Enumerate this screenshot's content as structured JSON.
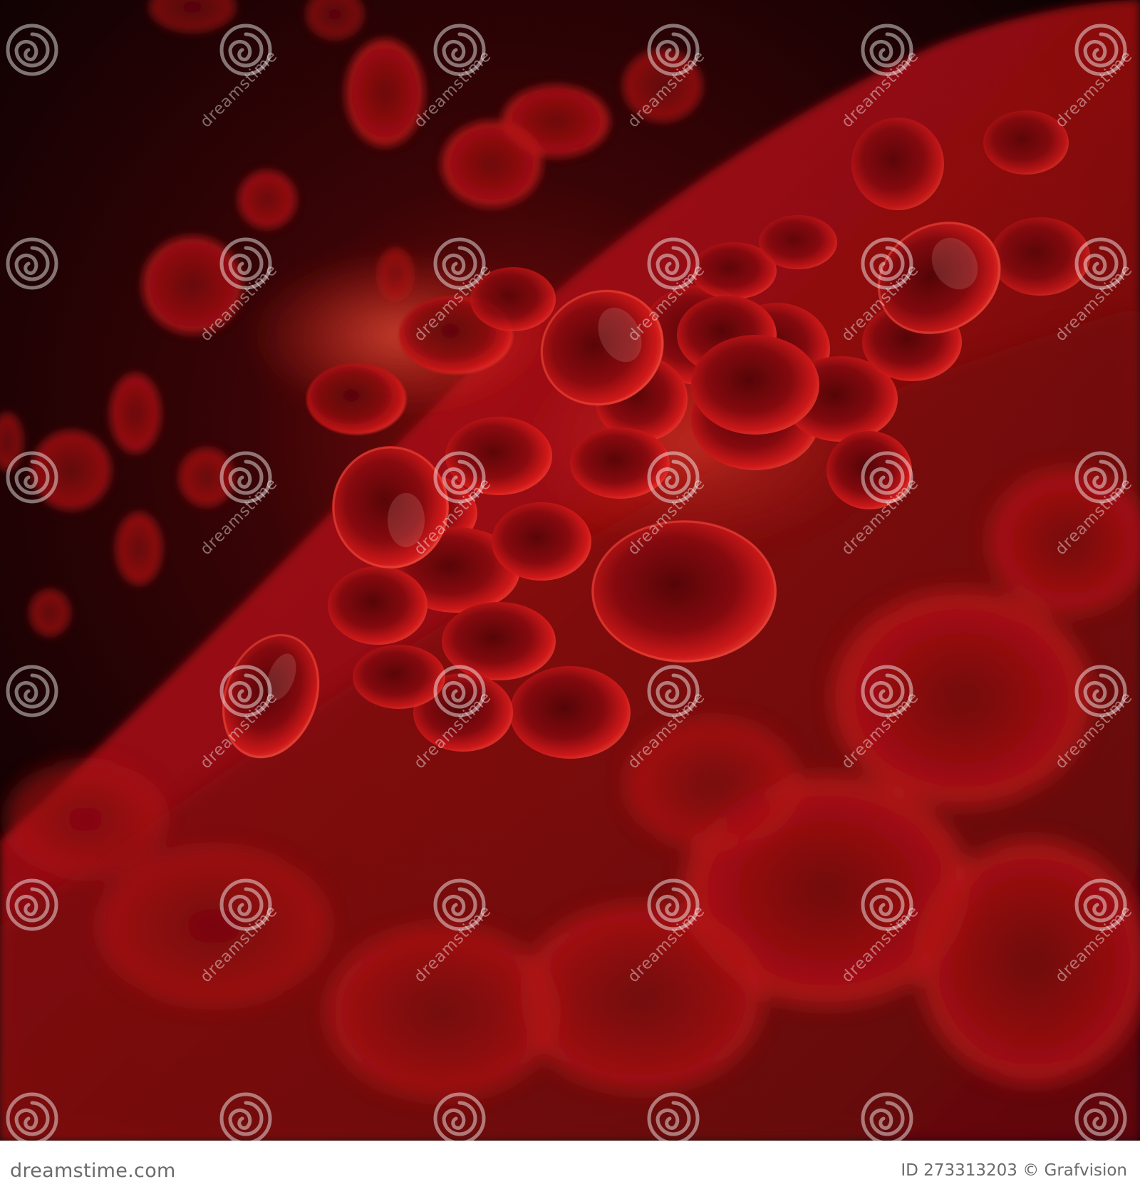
{
  "image": {
    "subject_colors": {
      "background": "#0d0405",
      "cell_dark": "#5a0508",
      "cell_mid": "#b00f14",
      "cell_bright": "#ff2a26",
      "glow": "#ff3a2a"
    }
  },
  "watermark": {
    "logo_icon": "spiral-logo-icon",
    "text": "dreamstime"
  },
  "footer": {
    "brand": "dreamstime.com",
    "id_label": "ID",
    "id_number": "273313203",
    "copyright_symbol": "©",
    "author": "Grafvision"
  }
}
